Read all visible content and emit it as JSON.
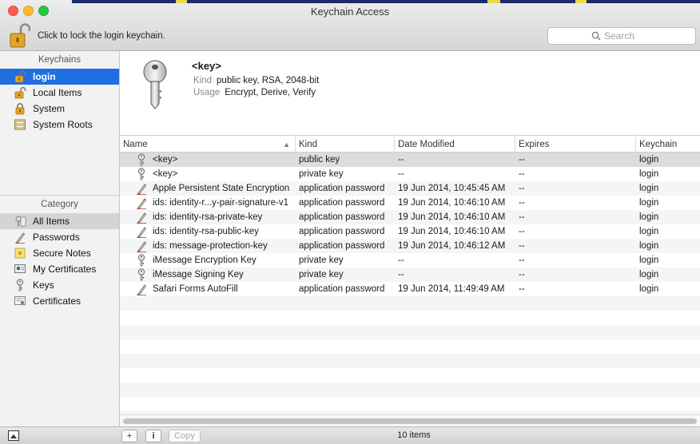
{
  "window": {
    "title": "Keychain Access",
    "lock_text": "Click to lock the login keychain."
  },
  "search": {
    "placeholder": "Search"
  },
  "sidebar": {
    "keychains_header": "Keychains",
    "keychains": [
      {
        "label": "login",
        "icon": "unlocked-padlock-icon"
      },
      {
        "label": "Local Items",
        "icon": "unlocked-padlock-icon"
      },
      {
        "label": "System",
        "icon": "locked-padlock-icon"
      },
      {
        "label": "System Roots",
        "icon": "certificate-cabinet-icon"
      }
    ],
    "category_header": "Category",
    "categories": [
      {
        "label": "All Items",
        "icon": "all-items-icon"
      },
      {
        "label": "Passwords",
        "icon": "pen-icon"
      },
      {
        "label": "Secure Notes",
        "icon": "note-icon"
      },
      {
        "label": "My Certificates",
        "icon": "certificate-icon"
      },
      {
        "label": "Keys",
        "icon": "key-icon"
      },
      {
        "label": "Certificates",
        "icon": "certificate-icon"
      }
    ]
  },
  "detail": {
    "title": "<key>",
    "kind_label": "Kind",
    "kind_value": "public key, RSA, 2048-bit",
    "usage_label": "Usage",
    "usage_value": "Encrypt, Derive, Verify"
  },
  "table": {
    "columns": [
      "Name",
      "Kind",
      "Date Modified",
      "Expires",
      "Keychain"
    ],
    "rows": [
      {
        "name": "<key>",
        "kind": "public key",
        "date": "--",
        "expires": "--",
        "keychain": "login",
        "icon": "key-icon"
      },
      {
        "name": "<key>",
        "kind": "private key",
        "date": "--",
        "expires": "--",
        "keychain": "login",
        "icon": "key-icon"
      },
      {
        "name": "Apple Persistent State Encryption",
        "kind": "application password",
        "date": "19 Jun 2014, 10:45:45 AM",
        "expires": "--",
        "keychain": "login",
        "icon": "pen-icon"
      },
      {
        "name": "ids: identity-r...y-pair-signature-v1",
        "kind": "application password",
        "date": "19 Jun 2014, 10:46:10 AM",
        "expires": "--",
        "keychain": "login",
        "icon": "pen-icon"
      },
      {
        "name": "ids: identity-rsa-private-key",
        "kind": "application password",
        "date": "19 Jun 2014, 10:46:10 AM",
        "expires": "--",
        "keychain": "login",
        "icon": "pen-icon"
      },
      {
        "name": "ids: identity-rsa-public-key",
        "kind": "application password",
        "date": "19 Jun 2014, 10:46:10 AM",
        "expires": "--",
        "keychain": "login",
        "icon": "pen-icon"
      },
      {
        "name": "ids: message-protection-key",
        "kind": "application password",
        "date": "19 Jun 2014, 10:46:12 AM",
        "expires": "--",
        "keychain": "login",
        "icon": "pen-icon"
      },
      {
        "name": "iMessage Encryption Key",
        "kind": "private key",
        "date": "--",
        "expires": "--",
        "keychain": "login",
        "icon": "key-icon"
      },
      {
        "name": "iMessage Signing Key",
        "kind": "private key",
        "date": "--",
        "expires": "--",
        "keychain": "login",
        "icon": "key-icon"
      },
      {
        "name": "Safari Forms AutoFill",
        "kind": "application password",
        "date": "19 Jun 2014, 11:49:49 AM",
        "expires": "--",
        "keychain": "login",
        "icon": "pen-icon"
      }
    ]
  },
  "bottom": {
    "add_label": "+",
    "info_label": "i",
    "copy_label": "Copy",
    "item_count": "10 items"
  },
  "colors": {
    "selection_blue": "#1f6fe0",
    "lock_gold": "#d9a020"
  }
}
